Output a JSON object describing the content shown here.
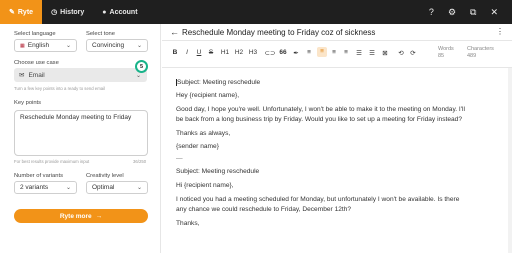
{
  "topbar": {
    "tabs": [
      {
        "label": "Ryte",
        "icon": "pen-icon",
        "active": true
      },
      {
        "label": "History",
        "icon": "clock-icon",
        "active": false
      },
      {
        "label": "Account",
        "icon": "user-icon",
        "active": false
      }
    ],
    "icons": [
      "help-icon",
      "settings-icon",
      "external-link-icon",
      "close-icon"
    ]
  },
  "form": {
    "language_label": "Select language",
    "language_value": "English",
    "tone_label": "Select tone",
    "tone_value": "Convincing",
    "usecase_label": "Choose use case",
    "usecase_value": "Email",
    "usecase_badge": "5",
    "usecase_hint": "Turn a few key points into a ready to send email",
    "keypoints_label": "Key points",
    "keypoints_value": "Reschedule Monday meeting to Friday",
    "keypoints_hint": "For best results provide maximum input",
    "keypoints_count": "36/250",
    "variants_label": "Number of variants",
    "variants_value": "2 variants",
    "creativity_label": "Creativity level",
    "creativity_value": "Optimal",
    "ryte_button": "Ryte more"
  },
  "document": {
    "title": "Reschedule Monday meeting to Friday coz of sickness",
    "toolbar": [
      "B",
      "I",
      "U",
      "S",
      "H1",
      "H2",
      "H3",
      "⊂⊃",
      "66",
      "✒",
      "≡",
      "≡",
      "≡",
      "≡",
      "☰",
      "☰",
      "⊠",
      "⟲",
      "⟳"
    ],
    "words_label": "Words",
    "words_value": "85",
    "chars_label": "Characters",
    "chars_value": "489",
    "lines": [
      "Subject: Meeting reschedule",
      "Hey {recipient name},",
      "Good day, I hope you're well. Unfortunately, I won't be able to make it to the meeting on Monday. I'll",
      "be back from a long business trip by Friday. Would you like to set up a meeting for Friday instead?",
      "Thanks as always,",
      "{sender name}",
      "—",
      "Subject: Meeting reschedule",
      "Hi {recipient name},",
      "I noticed you had a meeting scheduled for Monday, but unfortunately I won't be available. Is there",
      "any chance we could reschedule to Friday, December 12th?",
      "Thanks,"
    ]
  },
  "colors": {
    "accent": "#f29318",
    "topbar": "#1f1f1f",
    "badge_ring": "#19b38a"
  }
}
